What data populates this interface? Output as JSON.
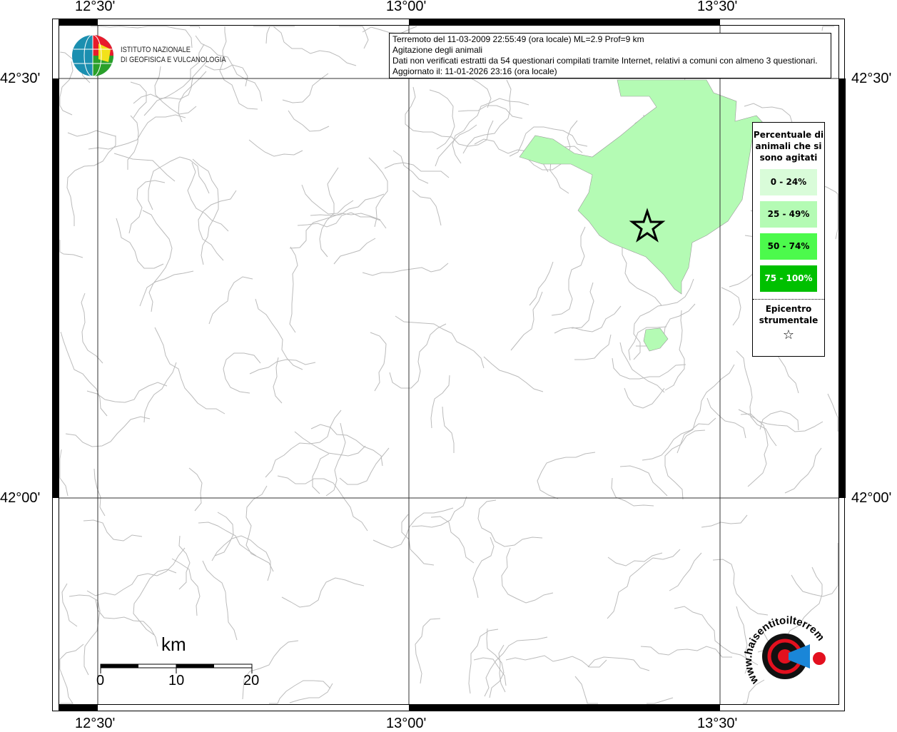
{
  "axes": {
    "lon_labels": [
      "12°30'",
      "13°00'",
      "13°30'"
    ],
    "lat_labels": [
      "42°30'",
      "42°00'"
    ]
  },
  "info": {
    "line1": "Terremoto del 11-03-2009 22:55:49 (ora locale) ML=2.9 Prof=9 km",
    "line2": "Agitazione degli animali",
    "line3": "Dati non verificati estratti da 54 questionari compilati tramite Internet, relativi a comuni con almeno 3 questionari.",
    "line4": "Aggiornato il: 11-01-2026 23:16 (ora locale)"
  },
  "logo": {
    "line1": "ISTITUTO NAZIONALE",
    "line2": "DI GEOFISICA E VULCANOLOGIA"
  },
  "legend": {
    "title": "Percentuale di animali che si sono agitati",
    "classes": [
      {
        "label": "0 - 24%",
        "color": "#d9fcd9"
      },
      {
        "label": "25 - 49%",
        "color": "#b4fbb4"
      },
      {
        "label": "50 - 74%",
        "color": "#4cfa4c"
      },
      {
        "label": "75 - 100%",
        "color": "#00c000"
      }
    ],
    "epicenter": "Epicentro strumentale"
  },
  "scale": {
    "unit": "km",
    "ticks": [
      "0",
      "10",
      "20"
    ]
  },
  "hst_logo": "www.haisentitoilterremoto.it"
}
